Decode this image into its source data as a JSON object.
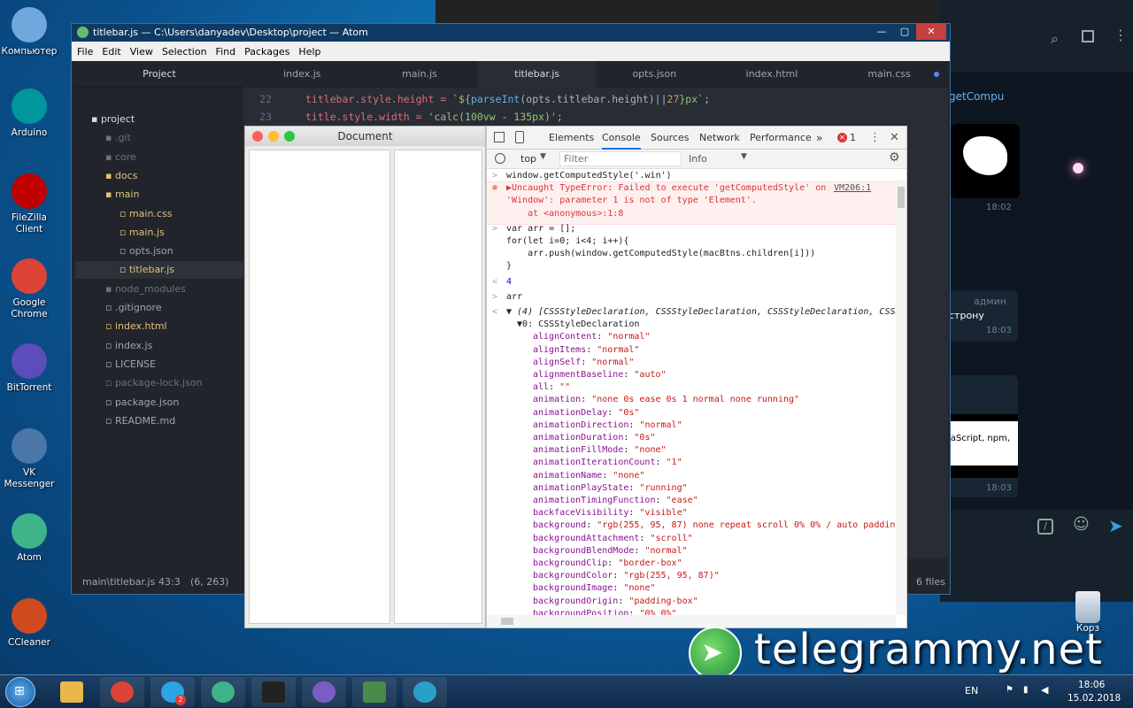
{
  "desktop": {
    "icons": [
      {
        "label": "Компьютер",
        "icon": "computer-icon",
        "color": "#6fa8dc"
      },
      {
        "label": "Arduino",
        "icon": "arduino-icon",
        "color": "#00979c"
      },
      {
        "label": "FileZilla Client",
        "icon": "filezilla-icon",
        "color": "#bf0000"
      },
      {
        "label": "Google Chrome",
        "icon": "chrome-icon",
        "color": "#db4437"
      },
      {
        "label": "BitTorrent",
        "icon": "bittorrent-icon",
        "color": "#5b4dba"
      },
      {
        "label": "VK Messenger",
        "icon": "vk-icon",
        "color": "#4a76a8"
      },
      {
        "label": "Atom",
        "icon": "atom-icon",
        "color": "#3eb489"
      },
      {
        "label": "CCleaner",
        "icon": "ccleaner-icon",
        "color": "#d04a1f"
      }
    ],
    "recycle_label": "Корз"
  },
  "atom": {
    "title": "titlebar.js — C:\\Users\\danyadev\\Desktop\\project — Atom",
    "menu": [
      "File",
      "Edit",
      "View",
      "Selection",
      "Find",
      "Packages",
      "Help"
    ],
    "project_header": "Project",
    "tree": [
      {
        "label": "project",
        "kind": "root"
      },
      {
        "label": ".git",
        "kind": "dir-dim"
      },
      {
        "label": "core",
        "kind": "dir-dim"
      },
      {
        "label": "docs",
        "kind": "dir-mod"
      },
      {
        "label": "main",
        "kind": "dir-open"
      },
      {
        "label": "main.css",
        "kind": "file-mod"
      },
      {
        "label": "main.js",
        "kind": "file-mod"
      },
      {
        "label": "opts.json",
        "kind": "file"
      },
      {
        "label": "titlebar.js",
        "kind": "file-active"
      },
      {
        "label": "node_modules",
        "kind": "dir-dim"
      },
      {
        "label": ".gitignore",
        "kind": "file"
      },
      {
        "label": "index.html",
        "kind": "file-mod"
      },
      {
        "label": "index.js",
        "kind": "file"
      },
      {
        "label": "LICENSE",
        "kind": "file"
      },
      {
        "label": "package-lock.json",
        "kind": "file-dim"
      },
      {
        "label": "package.json",
        "kind": "file"
      },
      {
        "label": "README.md",
        "kind": "file"
      }
    ],
    "tabs": [
      "index.js",
      "main.js",
      "titlebar.js",
      "opts.json",
      "index.html",
      "main.css"
    ],
    "active_tab": "titlebar.js",
    "gutter": [
      "22",
      "23"
    ],
    "code": [
      {
        "a": "titlebar.style.height = ",
        "b": "`${",
        "c": "parseInt",
        "d": "(opts.titlebar.height)||",
        "e": "27",
        "f": "}px`",
        ";": ";"
      },
      {
        "a": "title.style.width = ",
        "s": "'calc(100vw - 135px)'",
        ";": ";"
      }
    ],
    "status": {
      "path": "main\\titlebar.js",
      "pos": "43:3",
      "sel": "(6, 263)",
      "files": "6 files"
    }
  },
  "document": {
    "title": "Document"
  },
  "devtools": {
    "tabs": [
      "Elements",
      "Console",
      "Sources",
      "Network",
      "Performance"
    ],
    "active_tab": "Console",
    "more": "»",
    "errors": "1",
    "context": "top",
    "filter_placeholder": "Filter",
    "level": "Info",
    "lines": [
      {
        "p": ">",
        "t": "window.getComputedStyle('.win')",
        "k": "in"
      },
      {
        "p": "⊗",
        "t": "▶Uncaught TypeError: Failed to execute 'getComputedStyle' on",
        "k": "err",
        "src": "VM206:1"
      },
      {
        "p": "",
        "t": "'Window': parameter 1 is not of type 'Element'.",
        "k": "err"
      },
      {
        "p": "",
        "t": "    at <anonymous>:1:8",
        "k": "err"
      },
      {
        "p": ">",
        "t": "var arr = [];",
        "k": "in"
      },
      {
        "p": "",
        "t": "for(let i=0; i<4; i++){",
        "k": "in"
      },
      {
        "p": "",
        "t": "    arr.push(window.getComputedStyle(macBtns.children[i]))",
        "k": "in"
      },
      {
        "p": "",
        "t": "}",
        "k": "in"
      },
      {
        "p": "<",
        "t": "4",
        "k": "num"
      },
      {
        "p": ">",
        "t": "arr",
        "k": "in"
      },
      {
        "p": "<",
        "t": "▼ (4) [CSSStyleDeclaration, CSSStyleDeclaration, CSSStyleDeclaration, CSSSt",
        "k": "obj"
      },
      {
        "p": "",
        "t": "  ▼0: CSSStyleDeclaration",
        "k": "obj"
      }
    ],
    "props": [
      [
        "alignContent",
        "\"normal\""
      ],
      [
        "alignItems",
        "\"normal\""
      ],
      [
        "alignSelf",
        "\"normal\""
      ],
      [
        "alignmentBaseline",
        "\"auto\""
      ],
      [
        "all",
        "\"\""
      ],
      [
        "animation",
        "\"none 0s ease 0s 1 normal none running\""
      ],
      [
        "animationDelay",
        "\"0s\""
      ],
      [
        "animationDirection",
        "\"normal\""
      ],
      [
        "animationDuration",
        "\"0s\""
      ],
      [
        "animationFillMode",
        "\"none\""
      ],
      [
        "animationIterationCount",
        "\"1\""
      ],
      [
        "animationName",
        "\"none\""
      ],
      [
        "animationPlayState",
        "\"running\""
      ],
      [
        "animationTimingFunction",
        "\"ease\""
      ],
      [
        "backfaceVisibility",
        "\"visible\""
      ],
      [
        "background",
        "\"rgb(255, 95, 87) none repeat scroll 0% 0% / auto padding-"
      ],
      [
        "backgroundAttachment",
        "\"scroll\""
      ],
      [
        "backgroundBlendMode",
        "\"normal\""
      ],
      [
        "backgroundClip",
        "\"border-box\""
      ],
      [
        "backgroundColor",
        "\"rgb(255, 95, 87)\""
      ],
      [
        "backgroundImage",
        "\"none\""
      ],
      [
        "backgroundOrigin",
        "\"padding-box\""
      ],
      [
        "backgroundPosition",
        "\"0% 0%\""
      ]
    ]
  },
  "telegram": {
    "snippet1": "getCompu",
    "time1": "18:02",
    "sender": "админ",
    "snippet2": "строну",
    "time2": "18:03",
    "snippet3": "vaScript, npm,",
    "time3": "18:03"
  },
  "watermark": "telegrammy.net",
  "taskbar": {
    "lang": "EN",
    "time": "18:06",
    "date": "15.02.2018",
    "apps": [
      "explorer-icon",
      "chrome-icon",
      "telegram-icon",
      "atom-icon",
      "cmd-icon",
      "github-icon",
      "monitor-icon",
      "electron-icon"
    ],
    "telegram_badge": "2"
  }
}
